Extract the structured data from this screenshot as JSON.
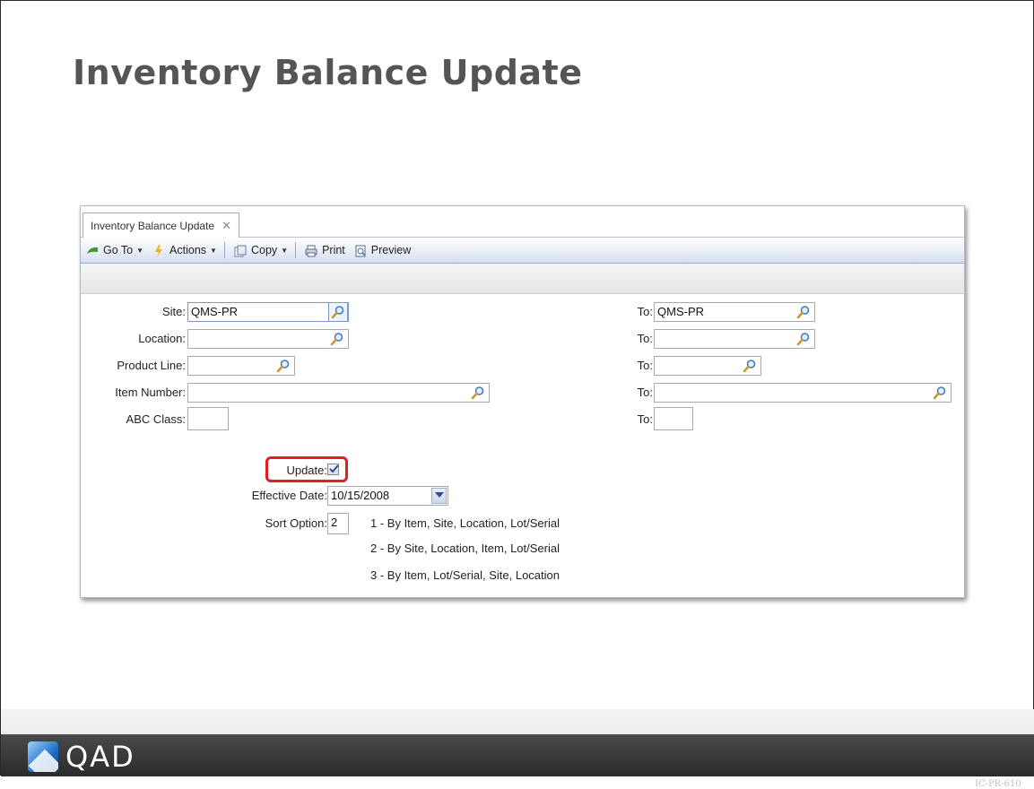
{
  "slide": {
    "title": "Inventory Balance Update",
    "code": "IC-PR-610",
    "logo_text": "QAD"
  },
  "window": {
    "tab_label": "Inventory Balance Update",
    "tab_close": "✕",
    "toolbar": {
      "goto": "Go To",
      "actions": "Actions",
      "copy": "Copy",
      "print": "Print",
      "preview": "Preview"
    }
  },
  "form": {
    "site": {
      "label": "Site:",
      "value": "QMS-PR",
      "to_label": "To:",
      "to_value": "QMS-PR"
    },
    "location": {
      "label": "Location:",
      "value": "",
      "to_label": "To:",
      "to_value": ""
    },
    "product_line": {
      "label": "Product Line:",
      "value": "",
      "to_label": "To:",
      "to_value": ""
    },
    "item_number": {
      "label": "Item Number:",
      "value": "",
      "to_label": "To:",
      "to_value": ""
    },
    "abc_class": {
      "label": "ABC Class:",
      "value": "",
      "to_label": "To:",
      "to_value": ""
    },
    "update": {
      "label": "Update:",
      "checked": true
    },
    "effective_date": {
      "label": "Effective Date:",
      "value": "10/15/2008"
    },
    "sort_option": {
      "label": "Sort Option:",
      "value": "2",
      "options": [
        "1 - By Item, Site, Location, Lot/Serial",
        "2 - By Site, Location, Item, Lot/Serial",
        "3 - By Item, Lot/Serial, Site, Location"
      ]
    }
  },
  "colors": {
    "highlight": "#e01f25",
    "title": "#555555",
    "footer_bar": "#2b2b2b"
  }
}
